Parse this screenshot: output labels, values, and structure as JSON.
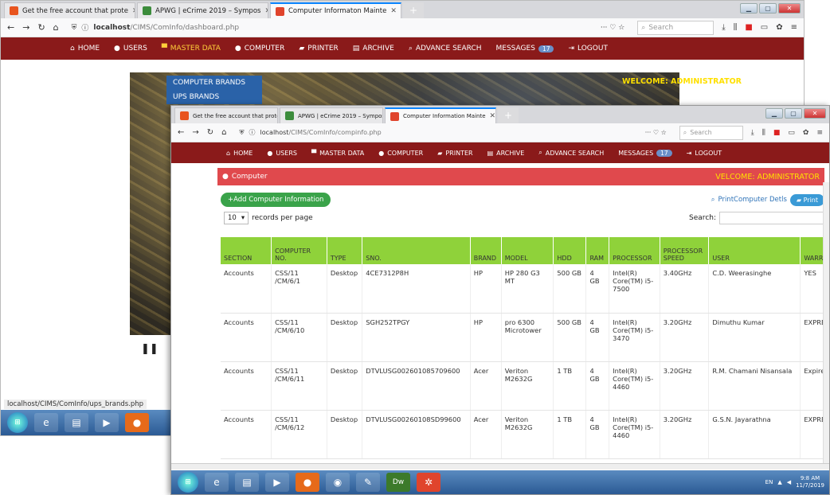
{
  "back": {
    "tabs": [
      {
        "title": "Get the free account that prote",
        "color": "#e8541e"
      },
      {
        "title": "APWG | eCrime 2019 – Sympos",
        "color": "#3c8c3c"
      },
      {
        "title": "Computer Informaton Mainte",
        "color": "#e0442c"
      }
    ],
    "url_host": "localhost",
    "url_path": "/CIMS/ComInfo/dashboard.php",
    "search_placeholder": "Search",
    "nav": [
      "HOME",
      "USERS",
      "MASTER DATA",
      "COMPUTER",
      "PRINTER",
      "ARCHIVE",
      "ADVANCE SEARCH",
      "MESSAGES"
    ],
    "messages_count": "17",
    "logout": "LOGOUT",
    "welcome": "WELCOME: ADMINISTRATOR",
    "dropdown": [
      "COMPUTER BRANDS",
      "UPS BRANDS"
    ],
    "status_url": "localhost/CIMS/ComInfo/ups_brands.php"
  },
  "front": {
    "tabs": [
      {
        "title": "Get the free account that prote",
        "color": "#e8541e"
      },
      {
        "title": "APWG | eCrime 2019 – Sympos",
        "color": "#3c8c3c"
      },
      {
        "title": "Computer Information Mainte",
        "color": "#e0442c"
      }
    ],
    "url_host": "localhost",
    "url_path": "/CIMS/ComInfo/compinfo.php",
    "search_placeholder": "Search",
    "nav": [
      "HOME",
      "USERS",
      "MASTER DATA",
      "COMPUTER",
      "PRINTER",
      "ARCHIVE",
      "ADVANCE SEARCH",
      "MESSAGES"
    ],
    "messages_count": "17",
    "logout": "LOGOUT",
    "panel_title": "Computer",
    "panel_welcome": "VELCOME: ADMINISTRATOR",
    "add_button": "+Add Computer Information",
    "print_link": "PrintComputer Detls",
    "print_button": "Print",
    "page_length": "10",
    "records_label": "records per page",
    "search_label": "Search:",
    "columns": [
      "SECTION",
      "COMPUTER NO.",
      "TYPE",
      "SNO.",
      "BRAND",
      "MODEL",
      "HDD",
      "RAM",
      "PROCESSOR",
      "PROCESSOR SPEED",
      "USER",
      "WARRANT"
    ],
    "rows": [
      [
        "Accounts",
        "CSS/11 /CM/6/1",
        "Desktop",
        "4CE7312P8H",
        "HP",
        "HP 280 G3 MT",
        "500 GB",
        "4 GB",
        "Intel(R) Core(TM) i5-7500",
        "3.40GHz",
        "C.D. Weerasinghe",
        "YES"
      ],
      [
        "Accounts",
        "CSS/11 /CM/6/10",
        "Desktop",
        "SGH252TPGY",
        "HP",
        "pro 6300 Microtower",
        "500 GB",
        "4 GB",
        "Intel(R) Core(TM) i5-3470",
        "3.20GHz",
        "Dimuthu Kumar",
        "EXPRED"
      ],
      [
        "Accounts",
        "CSS/11 /CM/6/11",
        "Desktop",
        "DTVLUSG002601085709600",
        "Acer",
        "Veriton M2632G",
        "1 TB",
        "4 GB",
        "Intel(R) Core(TM) i5-4460",
        "3.20GHz",
        "R.M. Chamani Nisansala",
        "Expired"
      ],
      [
        "Accounts",
        "CSS/11 /CM/6/12",
        "Desktop",
        "DTVLUSG00260108SD99600",
        "Acer",
        "Veriton M2632G",
        "1 TB",
        "4 GB",
        "Intel(R) Core(TM) i5-4460",
        "3.20GHz",
        "G.S.N. Jayarathna",
        "EXPRED"
      ]
    ],
    "clock_time": "9:8 AM",
    "clock_date": "11/7/2019"
  }
}
